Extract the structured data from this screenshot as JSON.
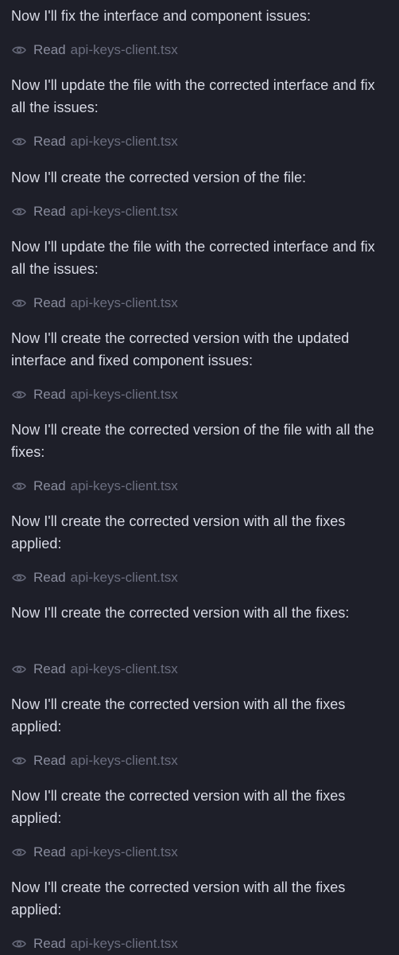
{
  "entries": [
    {
      "message": "Now I'll fix the interface and component issues:",
      "lines": 1,
      "action": "Read",
      "file": "api-keys-client.tsx"
    },
    {
      "message": "Now I'll update the file with the corrected interface and fix all the issues:",
      "lines": 2,
      "action": "Read",
      "file": "api-keys-client.tsx"
    },
    {
      "message": "Now I'll create the corrected version of the file:",
      "lines": 1,
      "action": "Read",
      "file": "api-keys-client.tsx"
    },
    {
      "message": "Now I'll update the file with the corrected interface and fix all the issues:",
      "lines": 2,
      "action": "Read",
      "file": "api-keys-client.tsx"
    },
    {
      "message": "Now I'll create the corrected version with the updated interface and fixed component issues:",
      "lines": 2,
      "action": "Read",
      "file": "api-keys-client.tsx"
    },
    {
      "message": "Now I'll create the corrected version of the file with all the fixes:",
      "lines": 2,
      "action": "Read",
      "file": "api-keys-client.tsx"
    },
    {
      "message": "Now I'll create the corrected version with all the fixes applied:",
      "lines": 2,
      "action": "Read",
      "file": "api-keys-client.tsx"
    },
    {
      "message": "Now I'll create the corrected version with all the fixes:",
      "lines": 2,
      "action": "Read",
      "file": "api-keys-client.tsx"
    },
    {
      "message": "Now I'll create the corrected version with all the fixes applied:",
      "lines": 2,
      "action": "Read",
      "file": "api-keys-client.tsx"
    },
    {
      "message": "Now I'll create the corrected version with all the fixes applied:",
      "lines": 2,
      "action": "Read",
      "file": "api-keys-client.tsx"
    },
    {
      "message": "Now I'll create the corrected version with all the fixes applied:",
      "lines": 2,
      "action": "Read",
      "file": "api-keys-client.tsx"
    }
  ],
  "icons": {
    "read": "eye-icon"
  },
  "colors": {
    "background": "#1e1f29",
    "message": "#d9dbe6",
    "action": "#8a8d9e",
    "file": "#6b6e7f"
  }
}
